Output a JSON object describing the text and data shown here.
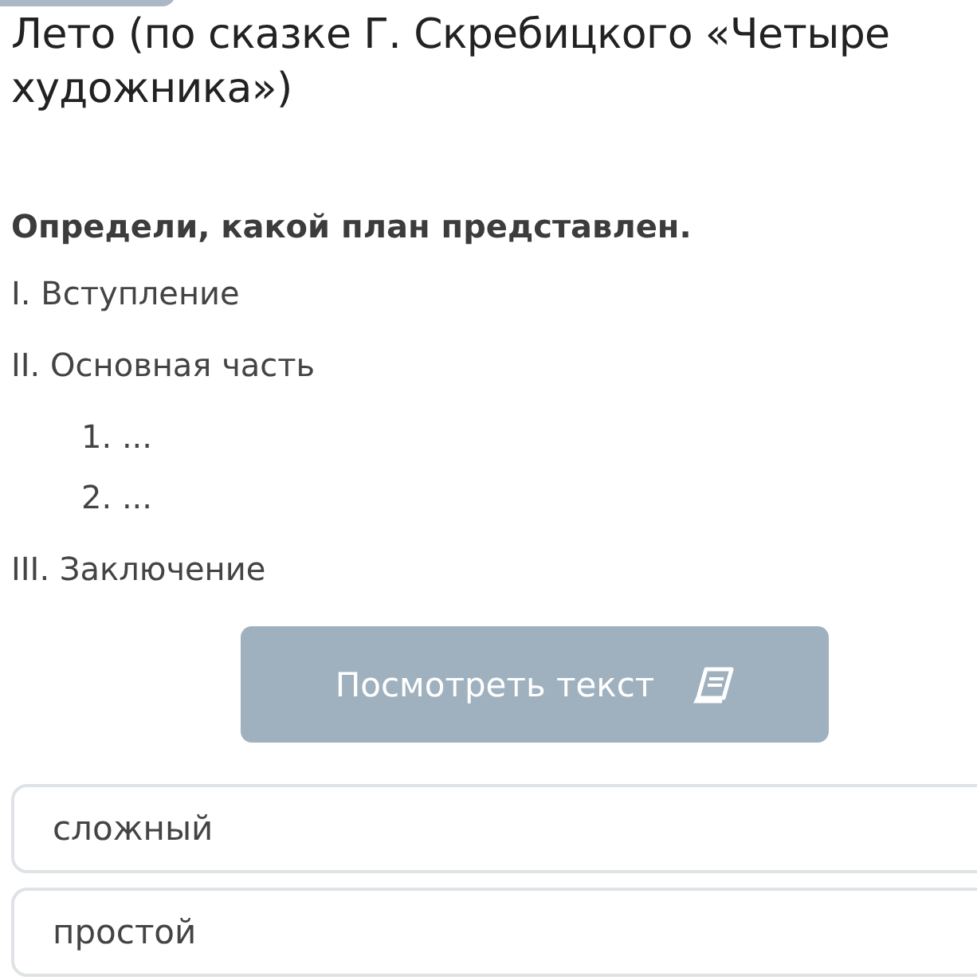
{
  "title": "Лето (по сказке Г. Скребицкого «Четыре художника»)",
  "question": "Определи, какой план представлен.",
  "plan": [
    {
      "kind": "section",
      "text": "I. Вступление"
    },
    {
      "kind": "section",
      "text": "II. Основная часть"
    },
    {
      "kind": "sub",
      "text": "1.  ..."
    },
    {
      "kind": "sub",
      "text": "2.  ..."
    },
    {
      "kind": "section",
      "text": "III. Заключение"
    }
  ],
  "view_button": {
    "label": "Посмотреть текст"
  },
  "options": [
    {
      "label": "сложный"
    },
    {
      "label": "простой"
    }
  ]
}
